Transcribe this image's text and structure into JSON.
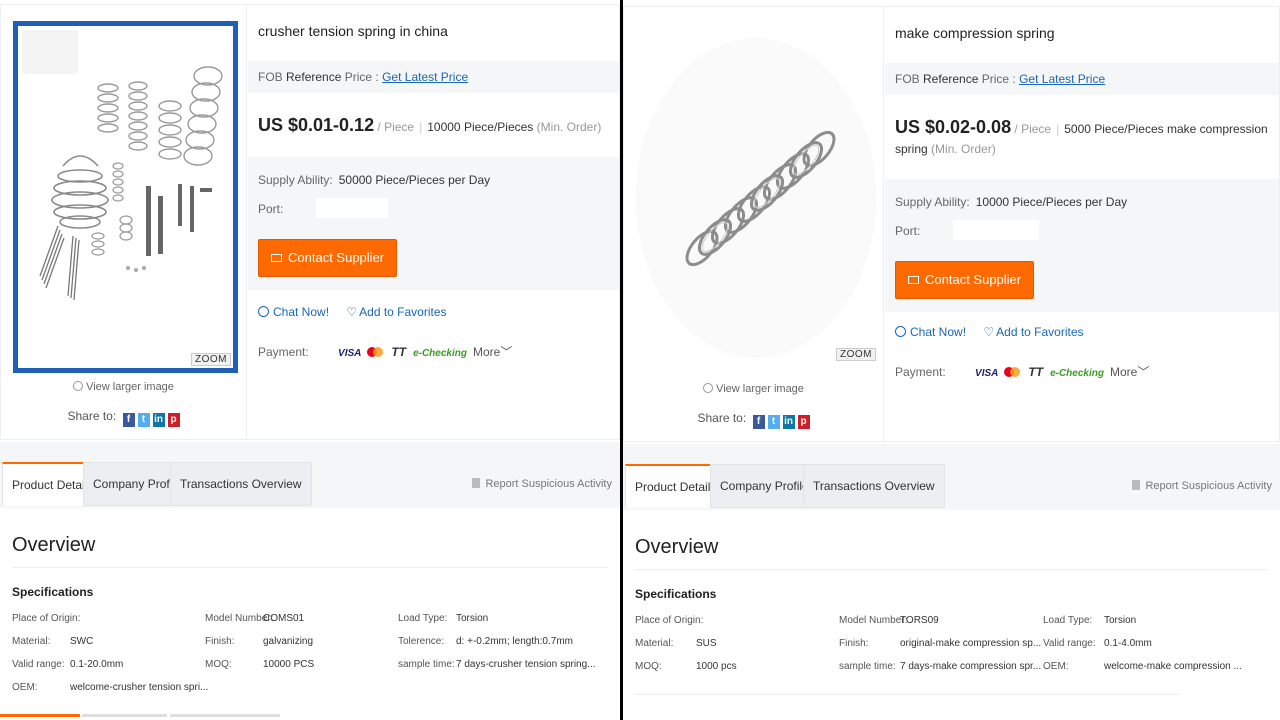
{
  "panels": [
    {
      "title": "crusher tension spring in china",
      "fob_prefix": "FOB",
      "fob_reference": "Reference",
      "fob_price_word": "Price :",
      "fob_link": "Get Latest Price",
      "price": "US $0.01-0.12",
      "unit": "/ Piece",
      "qty": "10000 Piece/Pieces",
      "moq_note": "(Min. Order)",
      "supply_label": "Supply Ability:",
      "supply_value": "50000 Piece/Pieces per Day",
      "port_label": "Port:",
      "contact": "Contact Supplier",
      "chat": "Chat Now!",
      "favorite": "Add to Favorites",
      "payment_label": "Payment:",
      "payment_visa": "VISA",
      "payment_tt": "TT",
      "payment_echecking": "e-Checking",
      "payment_more": "More",
      "zoom": "ZOOM",
      "view_larger": "View larger image",
      "share_to": "Share to:",
      "tabs": [
        "Product Details",
        "Company Profile",
        "Transactions Overview"
      ],
      "report": "Report Suspicious Activity",
      "overview": "Overview",
      "specifications": "Specifications",
      "specs": [
        {
          "label": "Place of Origin:",
          "value": ""
        },
        {
          "label": "Model Number:",
          "value": "COMS01"
        },
        {
          "label": "Load Type:",
          "value": "Torsion"
        },
        {
          "label": "Material:",
          "value": "SWC"
        },
        {
          "label": "Finish:",
          "value": "galvanizing"
        },
        {
          "label": "Tolerence:",
          "value": "d: +-0.2mm; length:0.7mm"
        },
        {
          "label": "Valid range:",
          "value": "0.1-20.0mm"
        },
        {
          "label": "MOQ:",
          "value": "10000 PCS"
        },
        {
          "label": "sample time:",
          "value": "7 days-crusher tension spring..."
        },
        {
          "label": "OEM:",
          "value": "welcome-crusher tension spri..."
        }
      ]
    },
    {
      "title": "make compression spring",
      "fob_prefix": "FOB",
      "fob_reference": "Reference",
      "fob_price_word": "Price :",
      "fob_link": "Get Latest Price",
      "price": "US $0.02-0.08",
      "unit": "/ Piece",
      "qty": "5000 Piece/Pieces make compression spring",
      "moq_note": "(Min. Order)",
      "supply_label": "Supply Ability:",
      "supply_value": "10000 Piece/Pieces per Day",
      "port_label": "Port:",
      "contact": "Contact Supplier",
      "chat": "Chat Now!",
      "favorite": "Add to Favorites",
      "payment_label": "Payment:",
      "payment_visa": "VISA",
      "payment_tt": "TT",
      "payment_echecking": "e-Checking",
      "payment_more": "More",
      "zoom": "ZOOM",
      "view_larger": "View larger image",
      "share_to": "Share to:",
      "tabs": [
        "Product Details",
        "Company Profile",
        "Transactions Overview"
      ],
      "report": "Report Suspicious Activity",
      "overview": "Overview",
      "specifications": "Specifications",
      "specs": [
        {
          "label": "Place of Origin:",
          "value": ""
        },
        {
          "label": "Model Number:",
          "value": "TORS09"
        },
        {
          "label": "Load Type:",
          "value": "Torsion"
        },
        {
          "label": "Material:",
          "value": "SUS"
        },
        {
          "label": "Finish:",
          "value": "original-make compression sp..."
        },
        {
          "label": "Valid range:",
          "value": "0.1-4.0mm"
        },
        {
          "label": "MOQ:",
          "value": "1000 pcs"
        },
        {
          "label": "sample time:",
          "value": "7 days-make compression spr..."
        },
        {
          "label": "OEM:",
          "value": "welcome-make compression ..."
        }
      ]
    }
  ],
  "colors": {
    "accent": "#ff6a00",
    "link": "#1a66b8",
    "frame": "#1f5fb8",
    "echecking": "#3a9d23"
  },
  "icons": [
    "envelope-icon",
    "chat-icon",
    "heart-icon",
    "magnifier-icon",
    "facebook-icon",
    "twitter-icon",
    "linkedin-icon",
    "pinterest-icon",
    "visa-icon",
    "mastercard-icon",
    "tt-icon",
    "echecking-icon",
    "chevron-down-icon",
    "flag-icon"
  ]
}
